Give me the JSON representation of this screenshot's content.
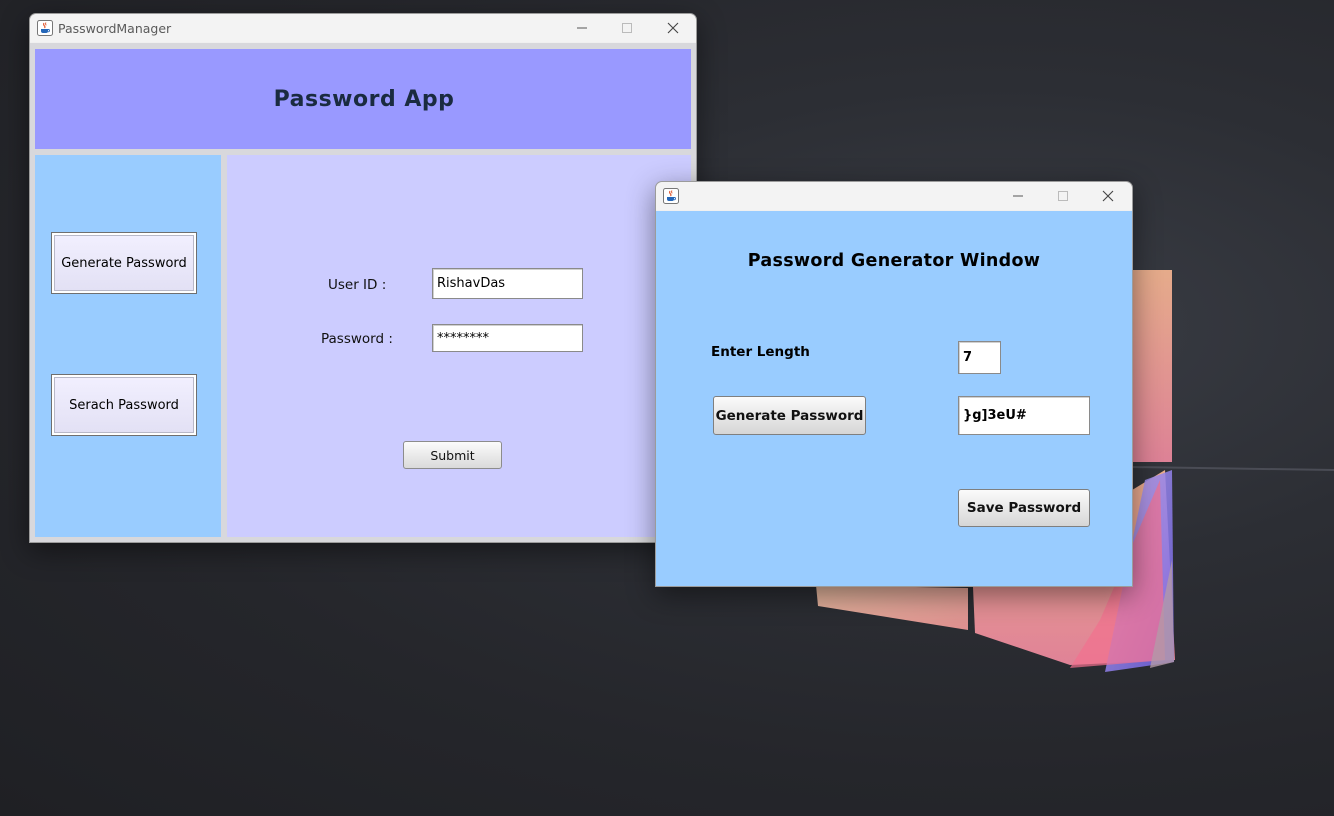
{
  "desktop": {
    "background": "#2a2b30"
  },
  "main_window": {
    "title": "PasswordManager",
    "icon": "java-cup-icon",
    "header_title": "Password App",
    "header_color": "#9999ff",
    "sidebar_color": "#99ccff",
    "form_color": "#ccccff",
    "sidebar": {
      "generate_label": "Generate Password",
      "search_label": "Serach Password"
    },
    "form": {
      "user_id_label": "User ID :",
      "user_id_value": "RishavDas",
      "password_label": "Password :",
      "password_value": "********",
      "submit_label": "Submit"
    }
  },
  "generator_window": {
    "title": "",
    "icon": "java-cup-icon",
    "heading": "Password Generator Window",
    "background": "#99ccff",
    "length_label": "Enter Length",
    "length_value": "7",
    "generate_label": "Generate Password",
    "generated_value": "}g]3eU#",
    "save_label": "Save Password"
  }
}
